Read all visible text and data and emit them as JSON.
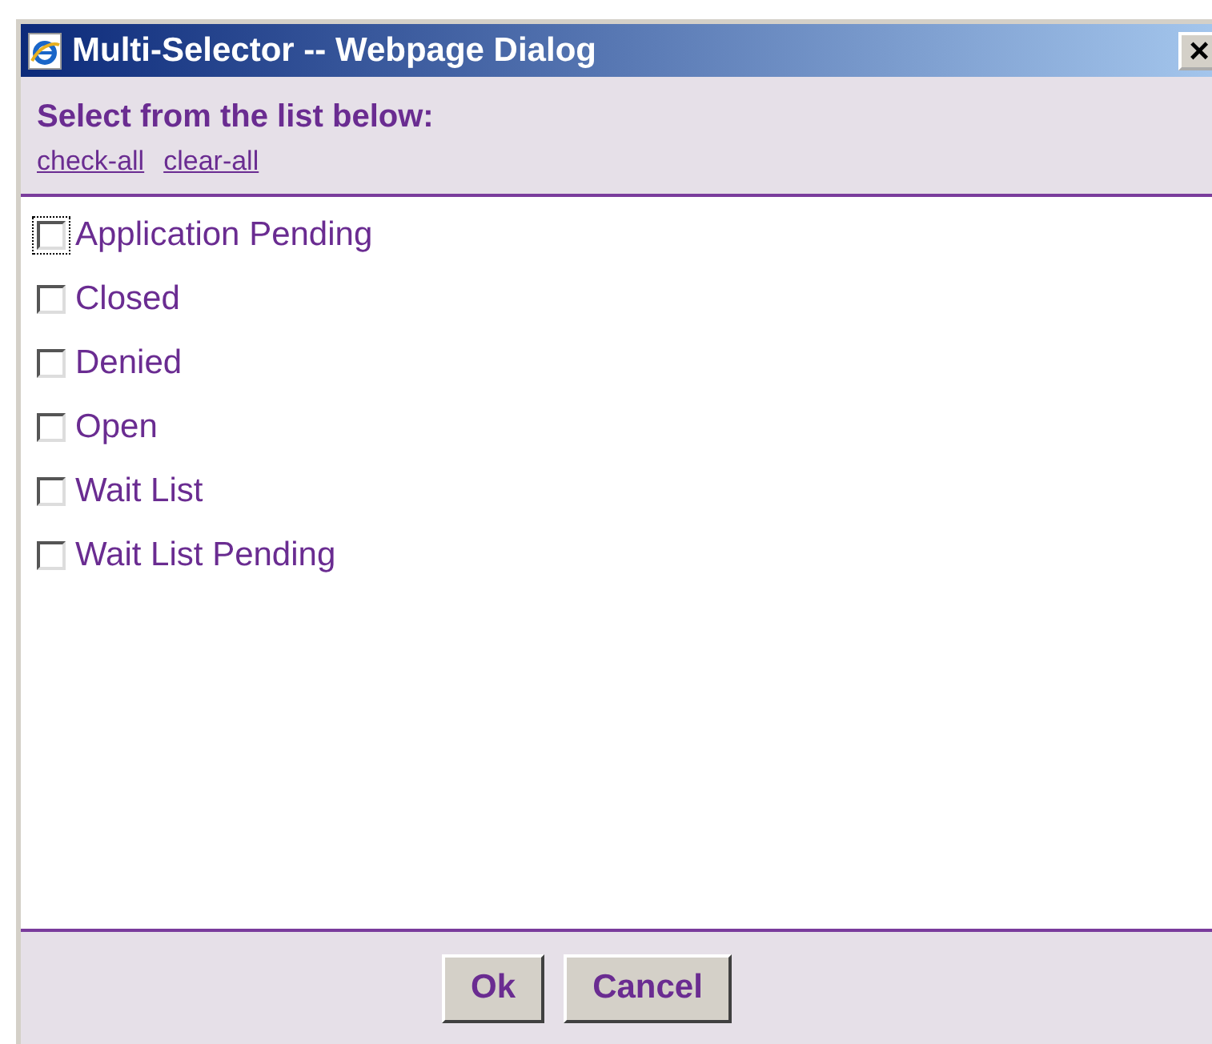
{
  "window": {
    "title": "Multi-Selector -- Webpage Dialog",
    "close": "×"
  },
  "header": {
    "prompt": "Select from the list below:",
    "links": [
      "check-all",
      "clear-all"
    ]
  },
  "items": [
    {
      "label": "Application Pending",
      "checked": false,
      "focused": true
    },
    {
      "label": "Closed",
      "checked": false,
      "focused": false
    },
    {
      "label": "Denied",
      "checked": false,
      "focused": false
    },
    {
      "label": "Open",
      "checked": false,
      "focused": false
    },
    {
      "label": "Wait List",
      "checked": false,
      "focused": false
    },
    {
      "label": "Wait List Pending",
      "checked": false,
      "focused": false
    }
  ],
  "buttons": [
    "Ok",
    "Cancel"
  ]
}
